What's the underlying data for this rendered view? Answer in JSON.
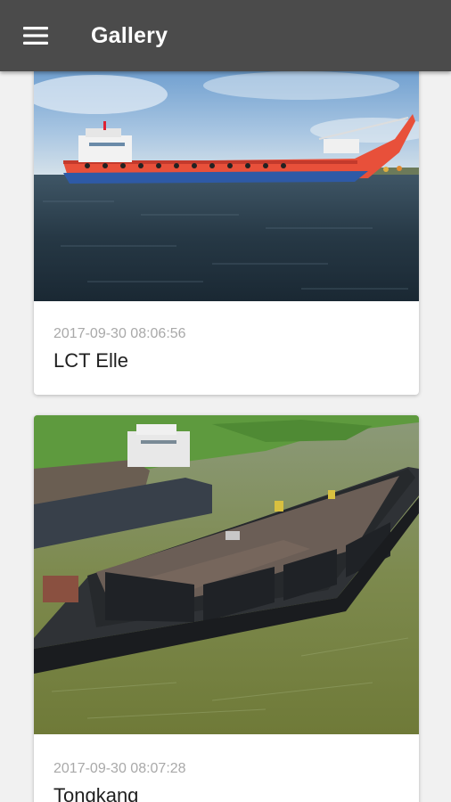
{
  "appbar": {
    "title": "Gallery",
    "menu_icon": "menu-icon",
    "background": "#4b4b4b"
  },
  "gallery": {
    "items": [
      {
        "date": "2017-09-30 08:06:56",
        "title": "LCT Elle",
        "image": "landing-craft-ship-photo"
      },
      {
        "date": "2017-09-30 08:07:28",
        "title": "Tongkang",
        "image": "barge-photo"
      }
    ]
  }
}
